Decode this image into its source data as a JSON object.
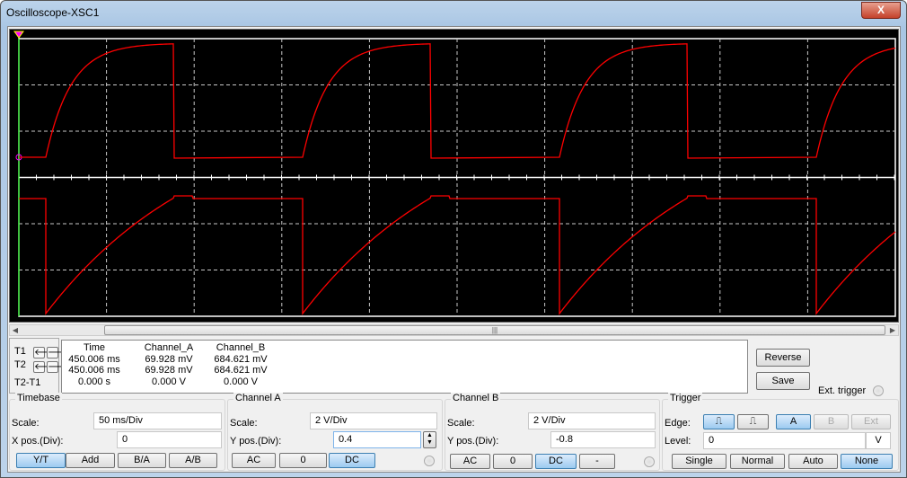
{
  "window": {
    "title": "Oscilloscope-XSC1",
    "close": "X"
  },
  "colors": {
    "trace": "#ff0000",
    "grid": "#c8c8c8",
    "cursor": "#00ff00"
  },
  "readout": {
    "rows": [
      "T1",
      "T2",
      "T2-T1"
    ],
    "headers": {
      "time": "Time",
      "a": "Channel_A",
      "b": "Channel_B"
    },
    "t1": {
      "time": "450.006 ms",
      "a": "69.928 mV",
      "b": "684.621 mV"
    },
    "t2": {
      "time": "450.006 ms",
      "a": "69.928 mV",
      "b": "684.621 mV"
    },
    "diff": {
      "time": "0.000 s",
      "a": "0.000 V",
      "b": "0.000 V"
    }
  },
  "side": {
    "reverse": "Reverse",
    "save": "Save",
    "ext_trigger": "Ext. trigger"
  },
  "timebase": {
    "title": "Timebase",
    "scale_label": "Scale:",
    "scale": "50 ms/Div",
    "xpos_label": "X pos.(Div):",
    "xpos": "0",
    "modes": [
      "Y/T",
      "Add",
      "B/A",
      "A/B"
    ]
  },
  "channel_a": {
    "title": "Channel A",
    "scale_label": "Scale:",
    "scale": "2  V/Div",
    "ypos_label": "Y pos.(Div):",
    "ypos": "0.4",
    "coupling": [
      "AC",
      "0",
      "DC"
    ]
  },
  "channel_b": {
    "title": "Channel B",
    "scale_label": "Scale:",
    "scale": "2  V/Div",
    "ypos_label": "Y pos.(Div):",
    "ypos": "-0.8",
    "coupling": [
      "AC",
      "0",
      "DC",
      "-"
    ]
  },
  "trigger": {
    "title": "Trigger",
    "edge_label": "Edge:",
    "sources": [
      "A",
      "B",
      "Ext"
    ],
    "level_label": "Level:",
    "level": "0",
    "level_unit": "V",
    "modes": [
      "Single",
      "Normal",
      "Auto",
      "None"
    ]
  }
}
